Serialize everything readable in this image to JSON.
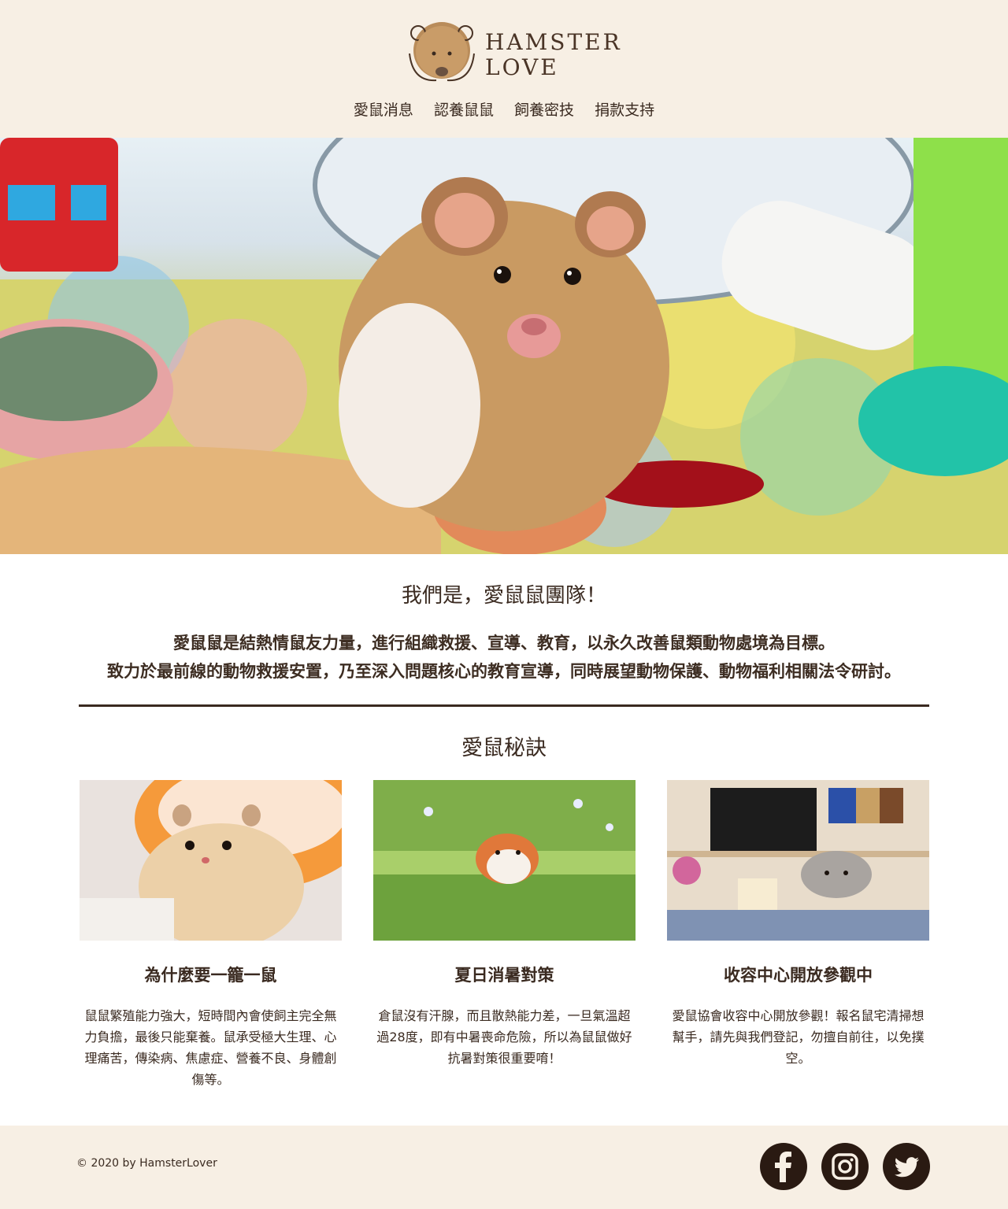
{
  "brand": {
    "line1": "HAMSTER",
    "line2": "LOVE"
  },
  "nav": [
    {
      "label": "愛鼠消息"
    },
    {
      "label": "認養鼠鼠"
    },
    {
      "label": "飼養密技"
    },
    {
      "label": "捐款支持"
    }
  ],
  "about": {
    "title": "我們是，愛鼠鼠團隊！",
    "line1": "愛鼠鼠是結熱情鼠友力量，進行組織救援、宣導、教育，以永久改善鼠類動物處境為目標。",
    "line2": "致力於最前線的動物救援安置，乃至深入問題核心的教育宣導，同時展望動物保護、動物福利相關法令研討。"
  },
  "tips": {
    "title": "愛鼠秘訣",
    "cards": [
      {
        "title": "為什麼要一籠一鼠",
        "desc": "鼠鼠繁殖能力強大，短時間內會使飼主完全無力負擔，最後只能棄養。鼠承受極大生理、心理痛苦，傳染病、焦慮症、營養不良、身體創傷等。"
      },
      {
        "title": "夏日消暑對策",
        "desc": "倉鼠沒有汗腺，而且散熱能力差，一旦氣溫超過28度，即有中暑喪命危險，所以為鼠鼠做好抗暑對策很重要唷！"
      },
      {
        "title": "收容中心開放參觀中",
        "desc": "愛鼠協會收容中心開放參觀！報名鼠宅清掃想幫手，請先與我們登記，勿擅自前往，以免撲空。"
      }
    ]
  },
  "footer": {
    "copyright": "© 2020 by HamsterLover"
  },
  "social": [
    "facebook-icon",
    "instagram-icon",
    "twitter-icon"
  ],
  "colors": {
    "cream": "#f7efe4",
    "brown": "#3a2a20",
    "hamster": "#c89a64"
  }
}
